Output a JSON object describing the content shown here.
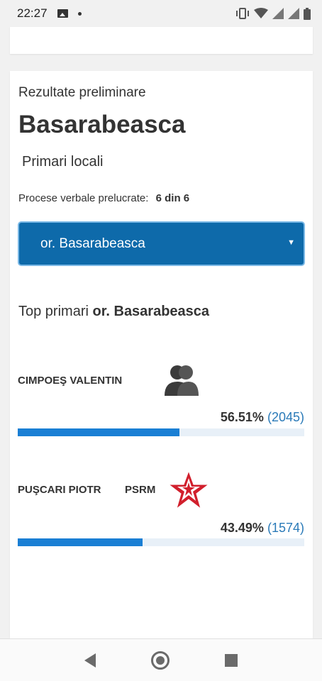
{
  "status_bar": {
    "time": "22:27",
    "icons": [
      "image-icon",
      "dot-icon",
      "vibrate-icon",
      "wifi-icon",
      "signal-icon",
      "signal-icon",
      "battery-icon"
    ]
  },
  "results": {
    "subtitle": "Rezultate preliminare",
    "title": "Basarabeasca",
    "election_type": "Primari locali",
    "processed_label": "Procese verbale prelucrate:",
    "processed_count": "6",
    "processed_of": "din",
    "processed_total": "6",
    "locality_select": "or. Basarabeasca",
    "top_label_prefix": "Top primari",
    "top_label_locality": "or. Basarabeasca"
  },
  "candidates": [
    {
      "name": "CIMPOEŞ VALENTIN",
      "party": "",
      "icon": "independent-candidate-icon",
      "percent": "56.51%",
      "votes": "(2045)",
      "share": 56.51
    },
    {
      "name": "PUŞCARI PIOTR",
      "party": "PSRM",
      "icon": "psrm-star-logo",
      "percent": "43.49%",
      "votes": "(1574)",
      "share": 43.49
    }
  ],
  "colors": {
    "select_bg": "#0e6aaa",
    "bar_fill": "#1a7fd4",
    "bar_track": "#e8f0f8",
    "vote_count": "#2a7ab8",
    "psrm_red": "#d11f2c"
  }
}
